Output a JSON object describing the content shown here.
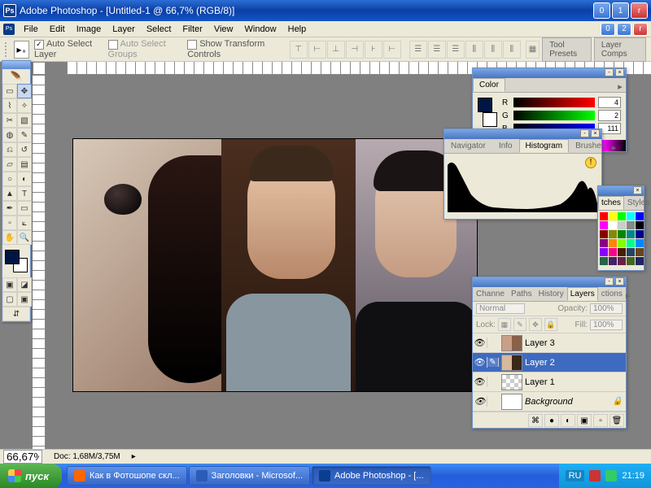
{
  "titlebar": {
    "title": "Adobe Photoshop - [Untitled-1 @ 66,7% (RGB/8)]"
  },
  "menu": [
    "File",
    "Edit",
    "Image",
    "Layer",
    "Select",
    "Filter",
    "View",
    "Window",
    "Help"
  ],
  "options": {
    "auto_select_layer": "Auto Select Layer",
    "auto_select_groups": "Auto Select Groups",
    "show_transform": "Show Transform Controls"
  },
  "palette_tabs": {
    "tool_presets": "Tool Presets",
    "layer_comps": "Layer Comps"
  },
  "color": {
    "tab": "Color",
    "R": {
      "label": "R",
      "value": "4"
    },
    "G": {
      "label": "G",
      "value": "2"
    },
    "B": {
      "label": "B",
      "value": "111"
    }
  },
  "histogram": {
    "tabs": [
      "Navigator",
      "Info",
      "Histogram",
      "Brushes"
    ],
    "active": "Histogram"
  },
  "swatches": {
    "tabs": [
      "tches",
      "Styles"
    ]
  },
  "layers": {
    "tabs": [
      "Channe",
      "Paths",
      "History",
      "Layers",
      "ctions"
    ],
    "active": "Layers",
    "blend_mode": "Normal",
    "opacity_label": "Opacity:",
    "opacity_value": "100%",
    "lock_label": "Lock:",
    "fill_label": "Fill:",
    "fill_value": "100%",
    "items": [
      {
        "name": "Layer 3"
      },
      {
        "name": "Layer 2"
      },
      {
        "name": "Layer 1"
      },
      {
        "name": "Background"
      }
    ]
  },
  "status": {
    "zoom": "66,67%",
    "doc": "Doc: 1,68M/3,75M"
  },
  "taskbar": {
    "start": "пуск",
    "items": [
      {
        "label": "Как в Фотошопе скл..."
      },
      {
        "label": "Заголовки - Microsof..."
      },
      {
        "label": "Adobe Photoshop - [..."
      }
    ],
    "lang": "RU",
    "time": "21:19"
  }
}
